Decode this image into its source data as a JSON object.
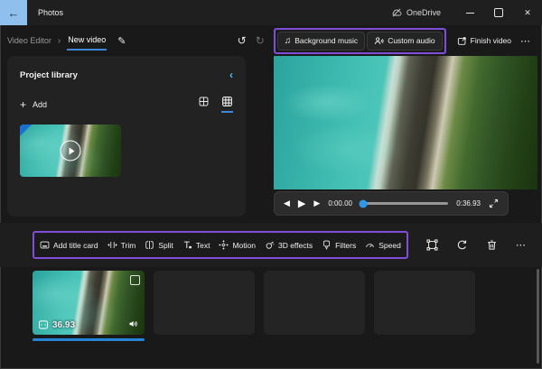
{
  "colors": {
    "highlight_purple": "#7e4ed9",
    "accent_blue": "#4cc2ff",
    "underline_blue": "#3f87d9",
    "back_button_bg": "#8fc0ed",
    "timeline_select_blue": "#2586d7"
  },
  "titlebar": {
    "app_title": "Photos",
    "onedrive_label": "OneDrive"
  },
  "breadcrumb": {
    "section": "Video Editor",
    "current": "New video"
  },
  "header_actions": {
    "background_music": "Background music",
    "custom_audio": "Custom audio",
    "finish_video": "Finish video"
  },
  "project_library": {
    "title": "Project library",
    "add_label": "Add"
  },
  "player": {
    "current_time": "0:00.00",
    "total_time": "0:36.93"
  },
  "edit_toolbar": {
    "items": [
      {
        "label": "Add title card"
      },
      {
        "label": "Trim"
      },
      {
        "label": "Split"
      },
      {
        "label": "Text"
      },
      {
        "label": "Motion"
      },
      {
        "label": "3D effects"
      },
      {
        "label": "Filters"
      },
      {
        "label": "Speed"
      }
    ]
  },
  "timeline": {
    "clip_duration": "36.93"
  },
  "icons": {
    "back": "←",
    "breadcrumb_chevron": "›",
    "edit_pencil": "✎",
    "undo": "↺",
    "redo": "↻",
    "music_note": "♫",
    "ellipsis": "⋯",
    "collapse_chevron": "‹",
    "add_plus": "+",
    "prev_frame": "◀",
    "play": "▶",
    "next_frame": "▶",
    "close": "✕"
  }
}
